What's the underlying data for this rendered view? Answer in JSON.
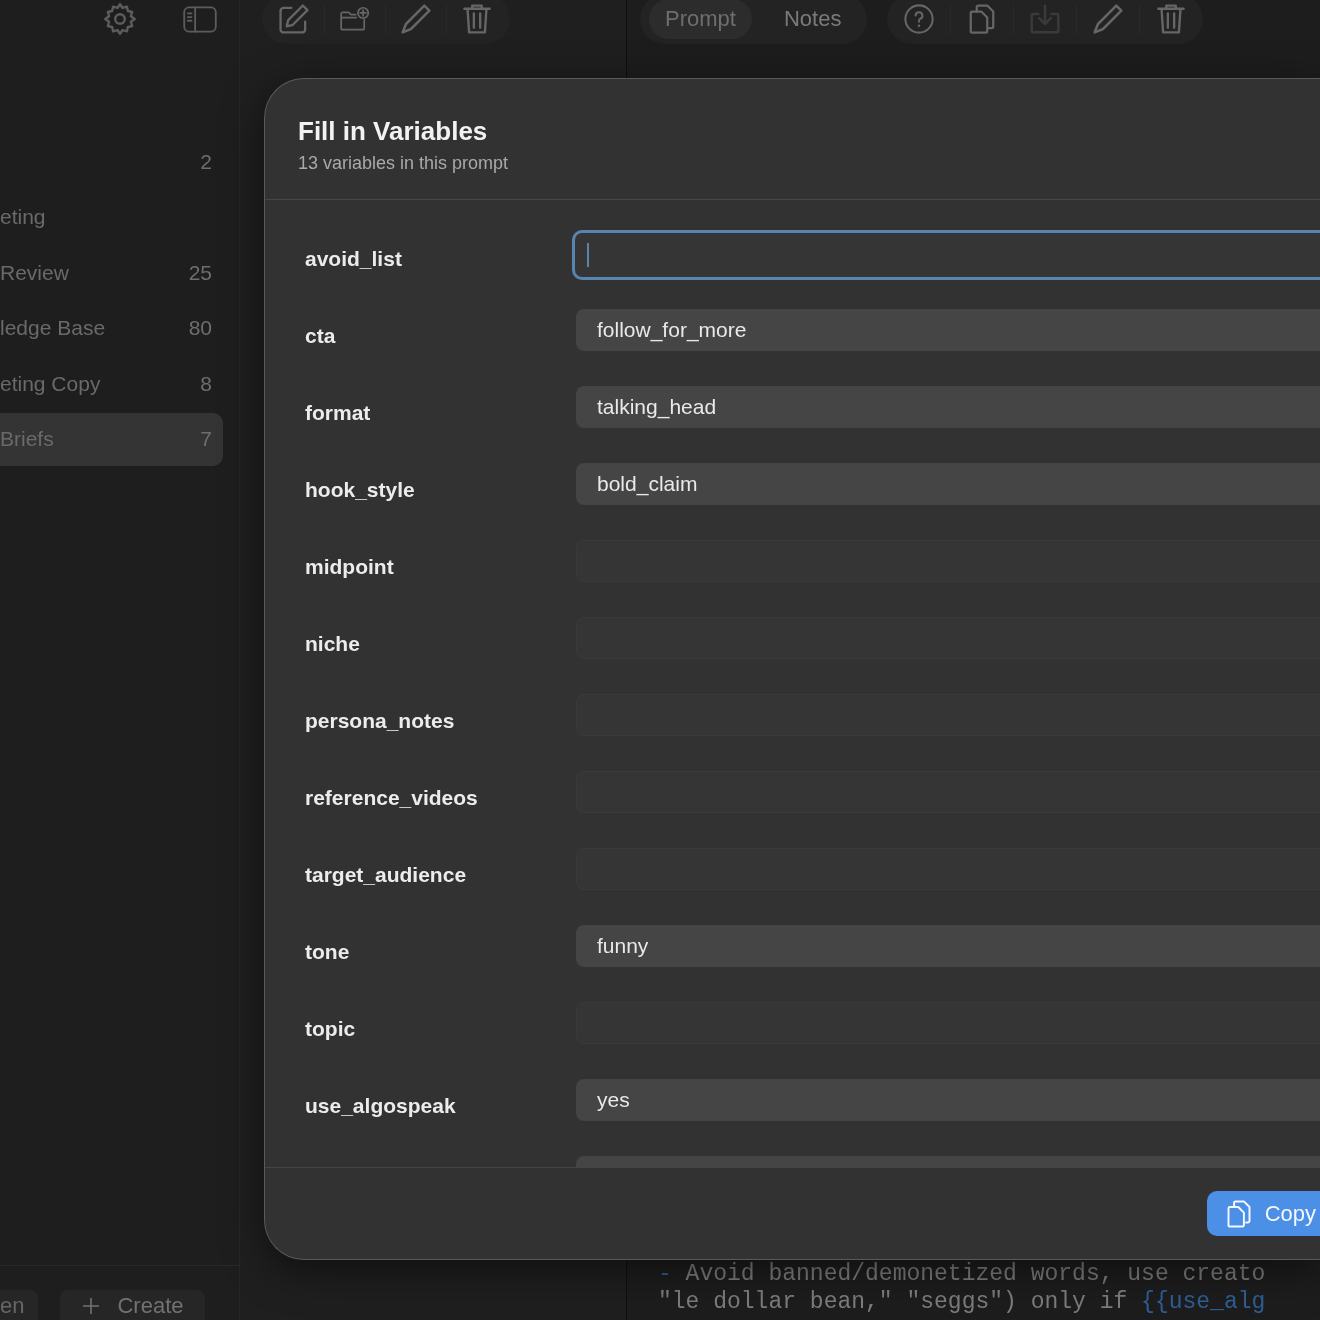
{
  "sidebar": {
    "items": [
      {
        "count": "2",
        "selected": false
      },
      {
        "label": "eting",
        "selected": false
      },
      {
        "label": "Review",
        "count": "25",
        "selected": false
      },
      {
        "label": "ledge Base",
        "count": "80",
        "selected": false
      },
      {
        "label": "eting Copy",
        "count": "8",
        "selected": false
      },
      {
        "label": "Briefs",
        "count": "7",
        "selected": true
      }
    ],
    "footer_buttons": [
      {
        "label": "en",
        "kind": "text"
      },
      {
        "label": "Create",
        "kind": "add"
      }
    ]
  },
  "detail_toolbar": {
    "tabs": [
      {
        "label": "Prompt",
        "selected": true
      },
      {
        "label": "Notes",
        "selected": false
      }
    ],
    "buttons": [
      {
        "disabled": false
      },
      {
        "disabled": false
      },
      {
        "disabled": true
      },
      {
        "disabled": false
      },
      {
        "disabled": false
      }
    ]
  },
  "editor": {
    "lines": [
      [
        {
          "kind": "bullet",
          "text": "-"
        },
        {
          "kind": "plain",
          "text": " Avoid banned/demonetized words, use creato"
        }
      ],
      [
        {
          "kind": "plain",
          "text": "\"le dollar bean,\" \"seggs\") only if "
        },
        {
          "kind": "variable",
          "text": "{{use_alg"
        }
      ]
    ]
  },
  "dialog": {
    "title": "Fill in Variables",
    "subtitle": "13 variables in this prompt",
    "variables": [
      {
        "name": "avoid_list",
        "focused": true,
        "filled": false
      },
      {
        "name": "cta",
        "value": "follow_for_more",
        "focused": false,
        "filled": true
      },
      {
        "name": "format",
        "value": "talking_head",
        "focused": false,
        "filled": true
      },
      {
        "name": "hook_style",
        "value": "bold_claim",
        "focused": false,
        "filled": true
      },
      {
        "name": "midpoint",
        "focused": false,
        "filled": false
      },
      {
        "name": "niche",
        "focused": false,
        "filled": false
      },
      {
        "name": "persona_notes",
        "focused": false,
        "filled": false
      },
      {
        "name": "reference_videos",
        "focused": false,
        "filled": false
      },
      {
        "name": "target_audience",
        "focused": false,
        "filled": false
      },
      {
        "name": "tone",
        "value": "funny",
        "focused": false,
        "filled": true
      },
      {
        "name": "topic",
        "focused": false,
        "filled": false
      },
      {
        "name": "use_algospeak",
        "value": "yes",
        "focused": false,
        "filled": true
      },
      {
        "focused": false,
        "filled": true
      }
    ],
    "copy_button": "Copy"
  }
}
